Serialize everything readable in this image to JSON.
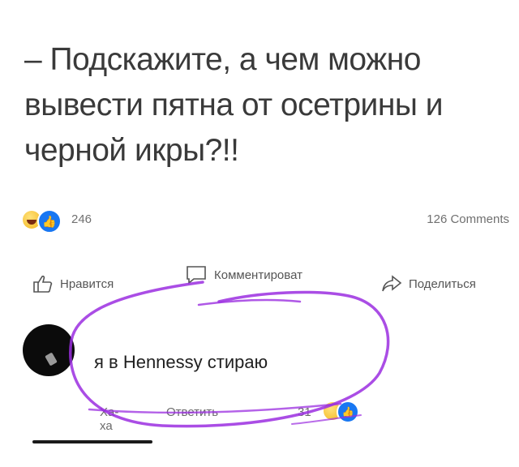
{
  "post": {
    "text": "– Подскажите, а чем можно\nвывести пятна от осетрины и\nчерной икры?!!"
  },
  "stats": {
    "reaction_count": "246",
    "comments_count": "126 Comments"
  },
  "actions": {
    "like_label": "Нравится",
    "comment_label": "Комментироват",
    "share_label": "Поделиться"
  },
  "comment": {
    "text": "я в Hennessy стираю",
    "haha_label": "Ха-ха",
    "reply_label": "Ответить",
    "reaction_count": "31"
  },
  "colors": {
    "marker_purple": "#9b2ee0",
    "like_blue": "#1877f2",
    "laugh_yellow": "#f3b61f"
  },
  "icons": {
    "laugh": "laugh-emoji-icon",
    "like": "like-thumb-icon",
    "comment": "comment-bubble-icon",
    "share": "share-arrow-icon"
  }
}
